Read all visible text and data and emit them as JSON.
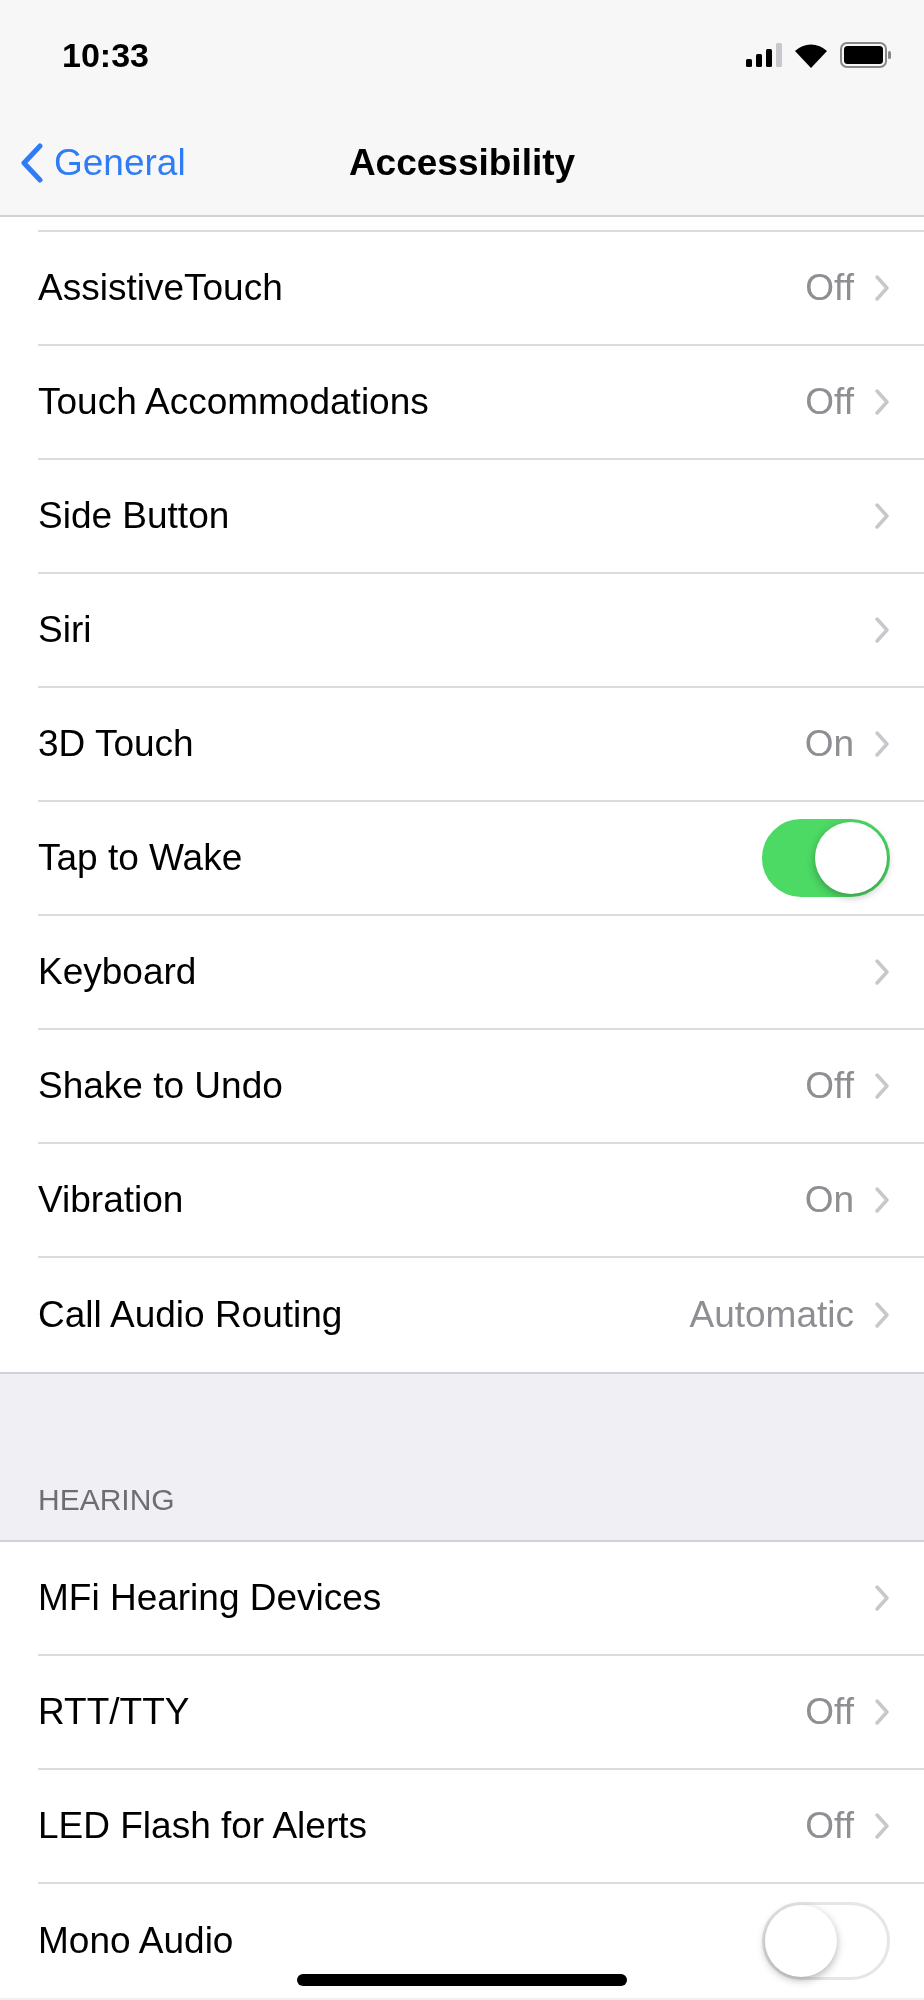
{
  "status_bar": {
    "time": "10:33"
  },
  "nav": {
    "back_label": "General",
    "title": "Accessibility"
  },
  "sections": [
    {
      "rows": [
        {
          "kind": "link",
          "label": "AssistiveTouch",
          "value": "Off"
        },
        {
          "kind": "link",
          "label": "Touch Accommodations",
          "value": "Off"
        },
        {
          "kind": "link",
          "label": "Side Button"
        },
        {
          "kind": "link",
          "label": "Siri"
        },
        {
          "kind": "link",
          "label": "3D Touch",
          "value": "On"
        },
        {
          "kind": "toggle",
          "label": "Tap to Wake",
          "on": true
        },
        {
          "kind": "link",
          "label": "Keyboard"
        },
        {
          "kind": "link",
          "label": "Shake to Undo",
          "value": "Off"
        },
        {
          "kind": "link",
          "label": "Vibration",
          "value": "On"
        },
        {
          "kind": "link",
          "label": "Call Audio Routing",
          "value": "Automatic"
        }
      ]
    },
    {
      "header": "HEARING",
      "rows": [
        {
          "kind": "link",
          "label": "MFi Hearing Devices"
        },
        {
          "kind": "link",
          "label": "RTT/TTY",
          "value": "Off"
        },
        {
          "kind": "link",
          "label": "LED Flash for Alerts",
          "value": "Off"
        },
        {
          "kind": "toggle",
          "label": "Mono Audio",
          "on": false
        }
      ]
    }
  ]
}
